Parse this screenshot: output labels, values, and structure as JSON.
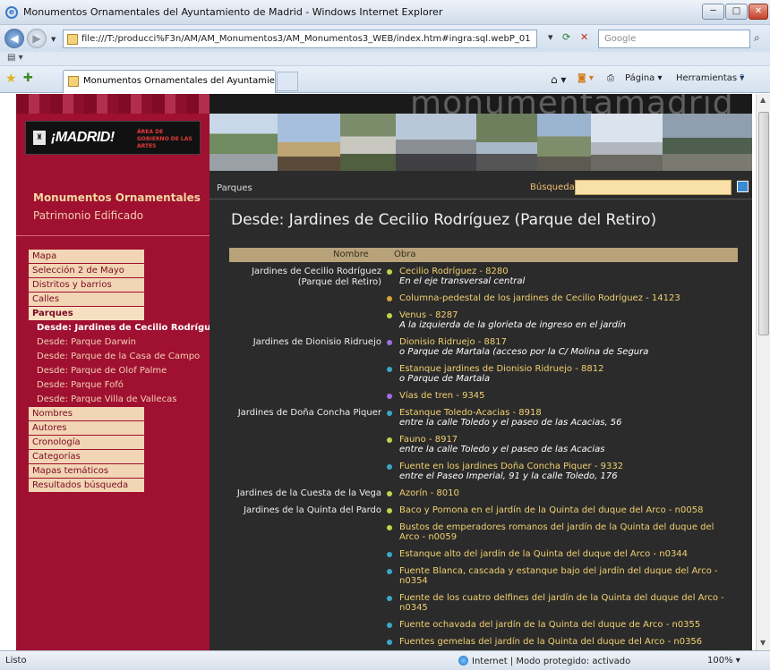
{
  "window": {
    "title": "Monumentos Ornamentales del Ayuntamiento de Madrid - Windows Internet Explorer",
    "min": "─",
    "max": "□",
    "close": "✕"
  },
  "address": {
    "url": "file:///T:/producci%F3n/AM/AM_Monumentos3/AM_Monumentos3_WEB/index.htm#ingra:sql.webP_01",
    "search_placeholder": "Google"
  },
  "tab": {
    "label": "Monumentos Ornamentales del Ayuntamiento d..."
  },
  "toolbar": {
    "page": "Página ▾",
    "tools": "Herramientas ▾"
  },
  "site": {
    "logo_text": "¡MADRID!",
    "logo_sub": "ÁREA DE GOBIERNO DE LAS ARTES",
    "brand": "monumentamadrid",
    "side_title": "Monumentos Ornamentales",
    "side_subtitle": "Patrimonio Edificado",
    "menu": [
      {
        "label": "Mapa",
        "kind": "main",
        "active": false
      },
      {
        "label": "Selección 2 de Mayo",
        "kind": "main",
        "active": false
      },
      {
        "label": "Distritos y barrios",
        "kind": "main",
        "active": false
      },
      {
        "label": "Calles",
        "kind": "main",
        "active": false
      },
      {
        "label": "Parques",
        "kind": "main",
        "active": true
      },
      {
        "label": "Desde: Jardines de Cecilio Rodríguez",
        "kind": "sub",
        "active": true
      },
      {
        "label": "Desde: Parque Darwin",
        "kind": "sub",
        "active": false
      },
      {
        "label": "Desde: Parque de la Casa de Campo",
        "kind": "sub",
        "active": false
      },
      {
        "label": "Desde: Parque de Olof Palme",
        "kind": "sub",
        "active": false
      },
      {
        "label": "Desde: Parque Fofó",
        "kind": "sub",
        "active": false
      },
      {
        "label": "Desde: Parque Villa de Vallecas",
        "kind": "sub",
        "active": false
      },
      {
        "label": "Nombres",
        "kind": "main",
        "active": false
      },
      {
        "label": "Autores",
        "kind": "main",
        "active": false
      },
      {
        "label": "Cronología",
        "kind": "main",
        "active": false
      },
      {
        "label": "Categorías",
        "kind": "main",
        "active": false
      },
      {
        "label": "Mapas temáticos",
        "kind": "main",
        "active": false
      },
      {
        "label": "Resultados búsqueda",
        "kind": "main",
        "active": false
      }
    ],
    "breadcrumb": "Parques",
    "search_label": "Búsqueda",
    "page_title": "Desde: Jardines de Cecilio Rodríguez (Parque del Retiro)",
    "table": {
      "col_nombre": "Nombre",
      "col_obra": "Obra",
      "rows": [
        {
          "place": "Jardines de Cecilio Rodríguez (Parque del Retiro)",
          "title": "Cecilio Rodríguez - 8280",
          "desc": "En el eje transversal central",
          "dot": "#b8d84a"
        },
        {
          "place": "",
          "title": "Columna-pedestal de los jardines de Cecilio Rodríguez - 14123",
          "desc": "",
          "dot": "#d9a436"
        },
        {
          "place": "",
          "title": "Venus - 8287",
          "desc": "A la izquierda de la glorieta de ingreso en el jardín",
          "dot": "#b8d84a"
        },
        {
          "place": "Jardines de Dionisio Ridruejo",
          "title": "Dionisio Ridruejo - 8817",
          "desc": "o Parque de Martala (acceso por la C/ Molina de Segura",
          "dot": "#a070e0"
        },
        {
          "place": "",
          "title": "Estanque jardines de Dionisio Ridruejo - 8812",
          "desc": "o Parque de Martala",
          "dot": "#3aa8c8"
        },
        {
          "place": "",
          "title": "Vías de tren - 9345",
          "desc": "",
          "dot": "#a070e0"
        },
        {
          "place": "Jardines de Doña Concha Piquer",
          "title": "Estanque Toledo-Acacias - 8918",
          "desc": "entre la calle Toledo y el paseo de las Acacias, 56",
          "dot": "#3aa8c8"
        },
        {
          "place": "",
          "title": "Fauno - 8917",
          "desc": "entre la calle Toledo y el paseo de las Acacias",
          "dot": "#b8d84a"
        },
        {
          "place": "",
          "title": "Fuente en los jardines Doña Concha Piquer - 9332",
          "desc": "entre el Paseo Imperial, 91 y la calle Toledo, 176",
          "dot": "#3aa8c8"
        },
        {
          "place": "Jardines de la Cuesta de la Vega",
          "title": "Azorín - 8010",
          "desc": "",
          "dot": "#b8d84a"
        },
        {
          "place": "Jardines de la Quinta del Pardo",
          "title": "Baco y Pomona en el jardín de la Quinta del duque del Arco - n0058",
          "desc": "",
          "dot": "#b8d84a"
        },
        {
          "place": "",
          "title": "Bustos de emperadores romanos del jardín de la Quinta del duque del Arco - n0059",
          "desc": "",
          "dot": "#b8d84a"
        },
        {
          "place": "",
          "title": "Estanque alto del jardín de la Quinta del duque del Arco - n0344",
          "desc": "",
          "dot": "#3aa8c8"
        },
        {
          "place": "",
          "title": "Fuente Blanca, cascada y estanque bajo del jardín del duque del Arco - n0354",
          "desc": "",
          "dot": "#3aa8c8"
        },
        {
          "place": "",
          "title": "Fuente de los cuatro delfines del jardín de la Quinta del duque del Arco - n0345",
          "desc": "",
          "dot": "#3aa8c8"
        },
        {
          "place": "",
          "title": "Fuente ochavada del jardín de la Quinta del duque de Arco - n0355",
          "desc": "",
          "dot": "#3aa8c8"
        },
        {
          "place": "",
          "title": "Fuentes gemelas del jardín de la Quinta del duque del Arco - n0356",
          "desc": "",
          "dot": "#3aa8c8"
        }
      ]
    }
  },
  "status": {
    "text": "Listo",
    "zone": "Internet | Modo protegido: activado",
    "zoom": "100%  ▾"
  }
}
